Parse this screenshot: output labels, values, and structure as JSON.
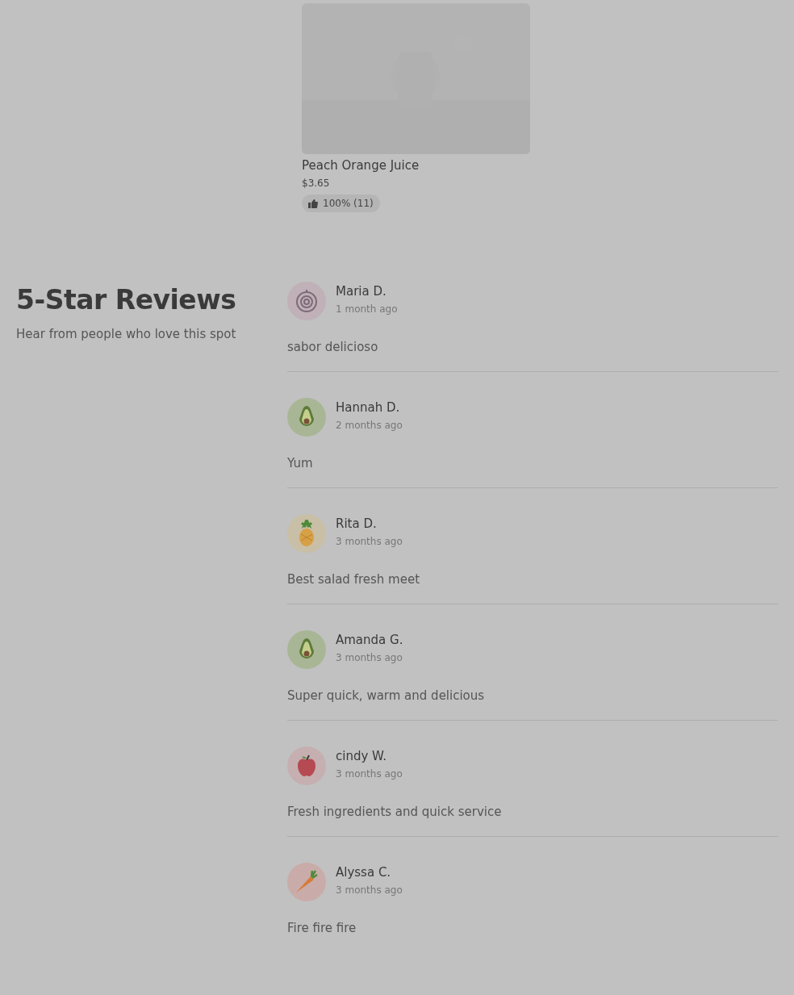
{
  "product": {
    "kind": "picture",
    "name": "Peach Orange Juice",
    "price": "$3.65",
    "rating": "100% (11)"
  },
  "reviews_section": {
    "title": "5-Star Reviews",
    "subtitle": "Hear from people who love this spot",
    "reviews": [
      {
        "kind": "onion",
        "name": "Maria D.",
        "time": "1 month ago",
        "text": "sabor delicioso"
      },
      {
        "kind": "avocado",
        "name": "Hannah D.",
        "time": "2 months ago",
        "text": "Yum"
      },
      {
        "kind": "pineapple",
        "name": "Rita D.",
        "time": "3 months ago",
        "text": "Best salad fresh meet"
      },
      {
        "kind": "avocado",
        "name": "Amanda G.",
        "time": "3 months ago",
        "text": "Super quick, warm and delicious"
      },
      {
        "kind": "apple",
        "name": "cindy W.",
        "time": "3 months ago",
        "text": "Fresh ingredients and quick service"
      },
      {
        "kind": "carrot",
        "name": "Alyssa C.",
        "time": "3 months ago",
        "text": "Fire fire fire"
      }
    ]
  }
}
